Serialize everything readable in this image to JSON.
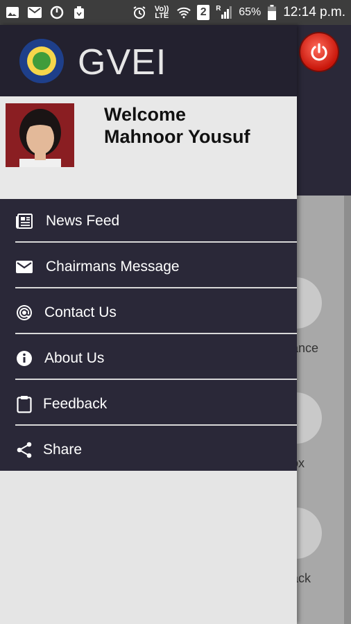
{
  "status_bar": {
    "volte_label": "Vo)) LTE",
    "sim_badge": "2",
    "signal_roaming": "R",
    "battery_percent": "65%",
    "time": "12:14 p.m.",
    "icons": [
      "image-icon",
      "gmail-icon",
      "sync-icon",
      "recycle-icon",
      "alarm-icon",
      "volte-icon",
      "wifi-icon",
      "sim-icon",
      "signal-icon",
      "battery-icon"
    ]
  },
  "drawer": {
    "app_title": "GVEI",
    "welcome_line1": "Welcome",
    "welcome_line2": "Mahnoor Yousuf",
    "menu": [
      {
        "label": "News Feed",
        "icon": "newspaper-icon"
      },
      {
        "label": "Chairmans Message",
        "icon": "mail-icon"
      },
      {
        "label": "Contact Us",
        "icon": "at-sign-icon"
      },
      {
        "label": "About Us",
        "icon": "info-icon"
      },
      {
        "label": "Feedback",
        "icon": "clipboard-icon"
      },
      {
        "label": "Share",
        "icon": "share-icon"
      }
    ]
  },
  "background": {
    "tile_labels": [
      "ance",
      "ox",
      "ack"
    ]
  },
  "colors": {
    "drawer_dark": "#2a2838",
    "drawer_header": "#23212f",
    "profile_bg": "#e8e8e8",
    "power_red": "#d8231a"
  }
}
